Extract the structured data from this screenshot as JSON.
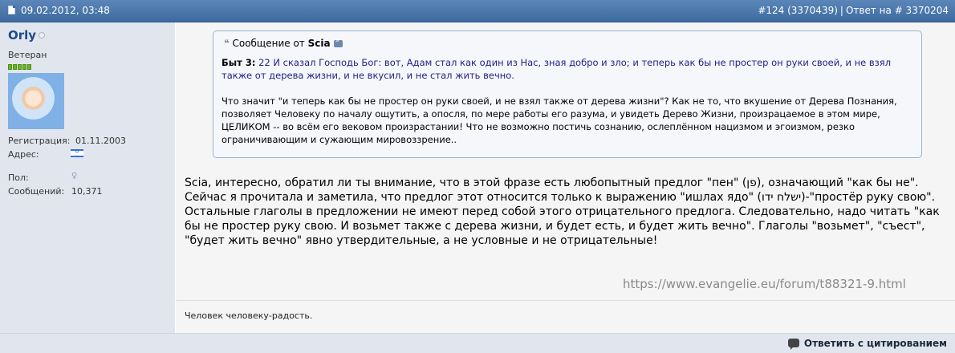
{
  "post": {
    "date": "09.02.2012, 03:48",
    "number": "#124 (3370439)",
    "reply_prefix": "Ответ на",
    "reply_to": "# 3370204"
  },
  "user": {
    "name": "Orly",
    "rank": "Ветеран",
    "reputation_level": 5,
    "registration_label": "Регистрация:",
    "registration_date": "01.11.2003",
    "address_label": "Адрес:",
    "gender_label": "Пол:",
    "messages_label": "Сообщений:",
    "messages_count": "10,371"
  },
  "quote": {
    "prefix": "Сообщение от",
    "author": "Scia",
    "verse_ref": "Быт 3:",
    "verse_text": "22 И сказал Господь Бог: вот, Адам стал как один из Нас, зная добро и зло; и теперь как бы не простер он руки своей, и не взял также от дерева жизни, и не вкусил, и не стал жить вечно.",
    "question": "Что значит \"и теперь как бы не простер он руки своей, и не взял также от дерева жизни\"? Как не то, что вкушение от Дерева Познания, позволяет Человеку по началу ощутить, а опосля, по мере работы его разума, и увидеть Дерево Жизни, произрацаемое в этом мире, ЦЕЛИКОМ -- во всём его вековом произрастании! Что не возможно постичь сознанию, ослеплённом нацизмом и эгоизмом, резко ограничивающим и сужающим мировоззрение.."
  },
  "message": {
    "text": "Scia, интересно, обратил ли ты внимание, что в этой фразе есть любопытный предлог \"пен\" (פן), означающий \"как бы не\". Сейчас я прочитала и заметила, что предлог этот относится только к выражению \"ишлах ядо\" (ישלח ידו)-\"простёр руку свою\". Остальные глаголы в предложении не имеют перед собой этого отрицательного предлога. Следовательно, надо читать \"как бы не простер руку свою. И возьмет также с дерева жизни, и будет есть, и будет жить вечно\". Глаголы \"возьмет\", \"съест\", \"будет жить вечно\" явно утвердительные, а не условные и не отрицательные!"
  },
  "watermark": "https://www.evangelie.eu/forum/t88321-9.html",
  "signature": "Человек человеку-радость.",
  "footer": {
    "reply_label": "Ответить с цитированием"
  },
  "icons": {
    "post_icon": "document-icon",
    "quote_icon": "quote-icon",
    "view_post_icon": "view-post-icon",
    "flag_icon": "israel-flag-icon",
    "gender_icon": "gender-unknown-icon",
    "reply_icon": "speech-bubble-icon"
  }
}
